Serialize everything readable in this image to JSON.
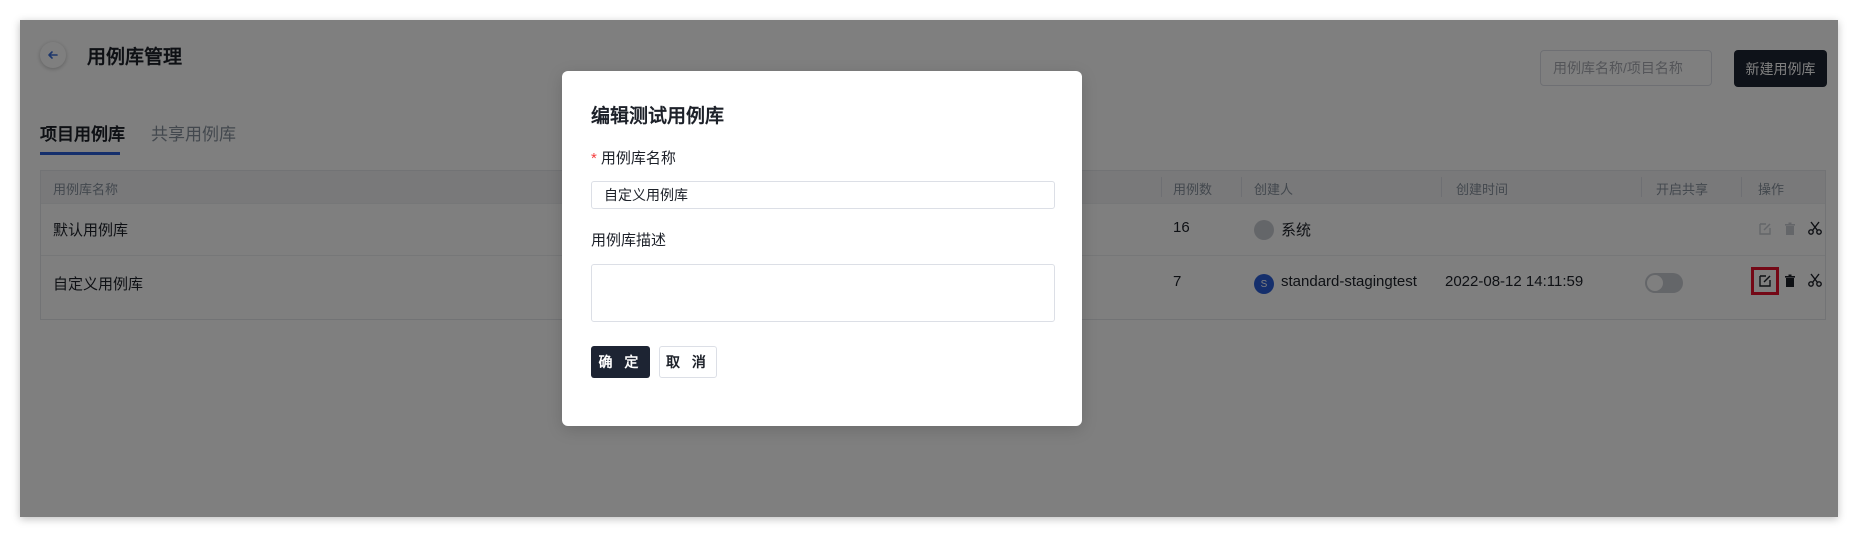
{
  "header": {
    "back_icon": "arrow-left-icon",
    "title": "用例库管理",
    "search_placeholder": "用例库名称/项目名称",
    "new_button": "新建用例库"
  },
  "tabs": [
    {
      "label": "项目用例库",
      "active": true
    },
    {
      "label": "共享用例库",
      "active": false
    }
  ],
  "table": {
    "columns": [
      "用例库名称",
      "用例数",
      "创建人",
      "创建时间",
      "开启共享",
      "操作"
    ],
    "rows": [
      {
        "name": "默认用例库",
        "count": "16",
        "creator": "系统",
        "avatar_letter": "",
        "created": "",
        "shared_toggle": false,
        "actions_enabled": false
      },
      {
        "name": "自定义用例库",
        "count": "7",
        "creator": "standard-stagingtest",
        "avatar_letter": "S",
        "created": "2022-08-12 14:11:59",
        "shared_toggle": true,
        "actions_enabled": true
      }
    ],
    "action_icons": [
      "edit-icon",
      "delete-icon",
      "scissors-icon"
    ]
  },
  "modal": {
    "title": "编辑测试用例库",
    "name_label": "用例库名称",
    "name_required_mark": "*",
    "name_value": "自定义用例库",
    "desc_label": "用例库描述",
    "desc_value": "",
    "ok_button": "确 定",
    "cancel_button": "取 消"
  },
  "colors": {
    "primary_dark": "#1d2433",
    "accent_blue": "#2b5fd9",
    "required_red": "#f53f3f",
    "highlight_red": "#e8112d"
  }
}
